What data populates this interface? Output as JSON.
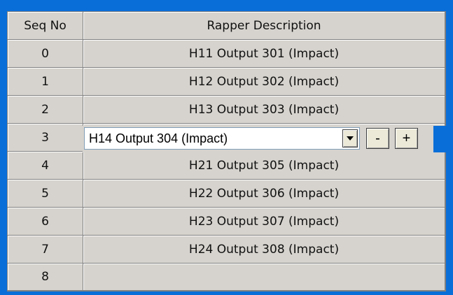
{
  "columns": {
    "seq_header": "Seq No",
    "desc_header": "Rapper Description"
  },
  "rows": [
    {
      "seq": "0",
      "desc": "H11  Output 301 (Impact)"
    },
    {
      "seq": "1",
      "desc": "H12  Output 302 (Impact)"
    },
    {
      "seq": "2",
      "desc": "H13  Output 303 (Impact)"
    },
    {
      "seq": "3",
      "desc": "H14  Output 304 (Impact)"
    },
    {
      "seq": "4",
      "desc": "H21  Output 305 (Impact)"
    },
    {
      "seq": "5",
      "desc": "H22  Output 306 (Impact)"
    },
    {
      "seq": "6",
      "desc": "H23  Output 307 (Impact)"
    },
    {
      "seq": "7",
      "desc": "H24  Output 308 (Impact)"
    },
    {
      "seq": "8",
      "desc": ""
    }
  ],
  "editor": {
    "selected_value": "H14  Output 304 (Impact)",
    "dropdown_icon": "chevron-down-icon",
    "minus_label": "-",
    "plus_label": "+"
  },
  "colors": {
    "background": "#0a6ed8",
    "grid": "#d6d3ce",
    "gridline": "#808080"
  }
}
